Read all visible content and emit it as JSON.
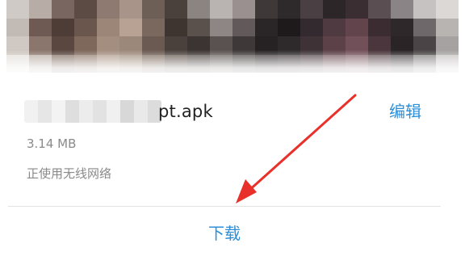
{
  "file": {
    "name_visible_suffix": "pt.apk",
    "size": "3.14 MB",
    "network_status": "正使用无线网络"
  },
  "actions": {
    "edit_label": "编辑",
    "download_label": "下载"
  },
  "colors": {
    "accent": "#2e8fd8",
    "annotation_arrow": "#e8312b",
    "secondary_text": "#8a8a8a",
    "divider": "#e2e2e2"
  },
  "icons": {
    "annotation": "red-arrow-annotation"
  }
}
